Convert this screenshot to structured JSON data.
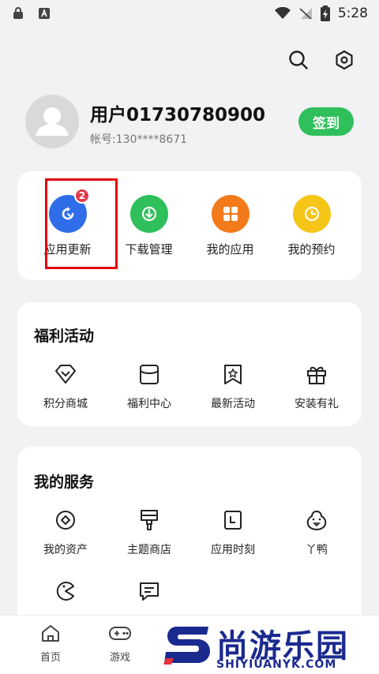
{
  "status_bar": {
    "time": "5:28"
  },
  "profile": {
    "username": "用户01730780900",
    "account_label": "帐号:",
    "account_value": "130****8671",
    "checkin_label": "签到"
  },
  "quick_actions": [
    {
      "label": "应用更新",
      "badge": "2",
      "color": "#2f6ee8",
      "icon": "refresh-icon"
    },
    {
      "label": "下载管理",
      "color": "#2fbf5b",
      "icon": "download-icon"
    },
    {
      "label": "我的应用",
      "color": "#f27a1a",
      "icon": "apps-grid-icon"
    },
    {
      "label": "我的预约",
      "color": "#f5c518",
      "icon": "clock-icon"
    }
  ],
  "welfare": {
    "title": "福利活动",
    "items": [
      {
        "label": "积分商城",
        "icon": "diamond-icon"
      },
      {
        "label": "福利中心",
        "icon": "bag-icon"
      },
      {
        "label": "最新活动",
        "icon": "star-bookmark-icon"
      },
      {
        "label": "安装有礼",
        "icon": "gift-icon"
      }
    ]
  },
  "services": {
    "title": "我的服务",
    "items": [
      {
        "label": "我的资产",
        "icon": "coin-icon"
      },
      {
        "label": "主题商店",
        "icon": "brush-icon"
      },
      {
        "label": "应用时刻",
        "icon": "calendar-icon"
      },
      {
        "label": "丫鸭",
        "icon": "duck-icon"
      }
    ]
  },
  "bottom_nav": [
    {
      "label": "首页",
      "icon": "home-icon"
    },
    {
      "label": "游戏",
      "icon": "gamepad-icon"
    }
  ],
  "watermark": {
    "text": "尚游乐园",
    "subtext": "SHIYIUANYK.COM"
  },
  "colors": {
    "accent_green": "#2fbf5b",
    "highlight_red": "#e3000f",
    "badge_red": "#e63a4c"
  }
}
